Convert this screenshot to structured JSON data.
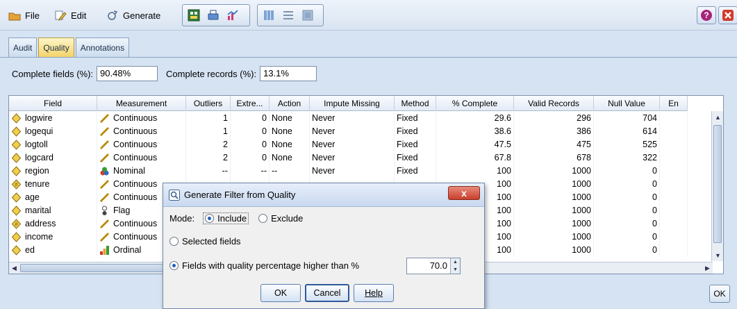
{
  "menu": {
    "file": "File",
    "edit": "Edit",
    "generate": "Generate"
  },
  "tabs": [
    {
      "label": "Audit",
      "active": false
    },
    {
      "label": "Quality",
      "active": true
    },
    {
      "label": "Annotations",
      "active": false
    }
  ],
  "summary": {
    "complete_fields_label": "Complete fields (%):",
    "complete_fields_value": "90.48%",
    "complete_records_label": "Complete records (%):",
    "complete_records_value": "13.1%"
  },
  "table": {
    "columns": [
      "Field",
      "Measurement",
      "Outliers",
      "Extre...",
      "Action",
      "Impute Missing",
      "Method",
      "% Complete",
      "Valid Records",
      "Null Value",
      "En"
    ],
    "rows": [
      {
        "field": "logwire",
        "icon": "continuous-field-icon",
        "measurement": "Continuous",
        "mtype": "continuous",
        "outliers": "1",
        "extremes": "0",
        "action": "None",
        "impute": "Never",
        "method": "Fixed",
        "complete": "29.6",
        "valid": "296",
        "null": "704"
      },
      {
        "field": "logequi",
        "icon": "continuous-field-icon",
        "measurement": "Continuous",
        "mtype": "continuous",
        "outliers": "1",
        "extremes": "0",
        "action": "None",
        "impute": "Never",
        "method": "Fixed",
        "complete": "38.6",
        "valid": "386",
        "null": "614"
      },
      {
        "field": "logtoll",
        "icon": "continuous-field-icon",
        "measurement": "Continuous",
        "mtype": "continuous",
        "outliers": "2",
        "extremes": "0",
        "action": "None",
        "impute": "Never",
        "method": "Fixed",
        "complete": "47.5",
        "valid": "475",
        "null": "525"
      },
      {
        "field": "logcard",
        "icon": "continuous-field-icon",
        "measurement": "Continuous",
        "mtype": "continuous",
        "outliers": "2",
        "extremes": "0",
        "action": "None",
        "impute": "Never",
        "method": "Fixed",
        "complete": "67.8",
        "valid": "678",
        "null": "322"
      },
      {
        "field": "region",
        "icon": "continuous-field-icon",
        "measurement": "Nominal",
        "mtype": "nominal",
        "outliers": "--",
        "extremes": "--",
        "action": "--",
        "impute": "Never",
        "method": "Fixed",
        "complete": "100",
        "valid": "1000",
        "null": "0"
      },
      {
        "field": "tenure",
        "icon": "integer-field-icon",
        "measurement": "Continuous",
        "mtype": "continuous",
        "outliers": "",
        "extremes": "",
        "action": "",
        "impute": "",
        "method": "",
        "complete": "100",
        "valid": "1000",
        "null": "0"
      },
      {
        "field": "age",
        "icon": "continuous-field-icon",
        "measurement": "Continuous",
        "mtype": "continuous",
        "outliers": "",
        "extremes": "",
        "action": "",
        "impute": "",
        "method": "",
        "complete": "100",
        "valid": "1000",
        "null": "0"
      },
      {
        "field": "marital",
        "icon": "continuous-field-icon",
        "measurement": "Flag",
        "mtype": "flag",
        "outliers": "",
        "extremes": "",
        "action": "",
        "impute": "",
        "method": "",
        "complete": "100",
        "valid": "1000",
        "null": "0"
      },
      {
        "field": "address",
        "icon": "integer-field-icon",
        "measurement": "Continuous",
        "mtype": "continuous",
        "outliers": "",
        "extremes": "",
        "action": "",
        "impute": "",
        "method": "",
        "complete": "100",
        "valid": "1000",
        "null": "0"
      },
      {
        "field": "income",
        "icon": "continuous-field-icon",
        "measurement": "Continuous",
        "mtype": "continuous",
        "outliers": "",
        "extremes": "",
        "action": "",
        "impute": "",
        "method": "",
        "complete": "100",
        "valid": "1000",
        "null": "0"
      },
      {
        "field": "ed",
        "icon": "continuous-field-icon",
        "measurement": "Ordinal",
        "mtype": "ordinal",
        "outliers": "",
        "extremes": "",
        "action": "",
        "impute": "",
        "method": "",
        "complete": "100",
        "valid": "1000",
        "null": "0"
      }
    ]
  },
  "main_ok": "OK",
  "dialog": {
    "title": "Generate Filter from Quality",
    "close_glyph": "x",
    "mode_label": "Mode:",
    "include_label": "Include",
    "exclude_label": "Exclude",
    "selected_fields_label": "Selected fields",
    "quality_label": "Fields with quality percentage higher than %",
    "quality_value": "70.0",
    "ok_label": "OK",
    "cancel_label": "Cancel",
    "help_label": "Help"
  },
  "colors": {
    "accent": "#3b6fb6",
    "active_tab": "#f3d36a",
    "close_red": "#c7402c"
  }
}
